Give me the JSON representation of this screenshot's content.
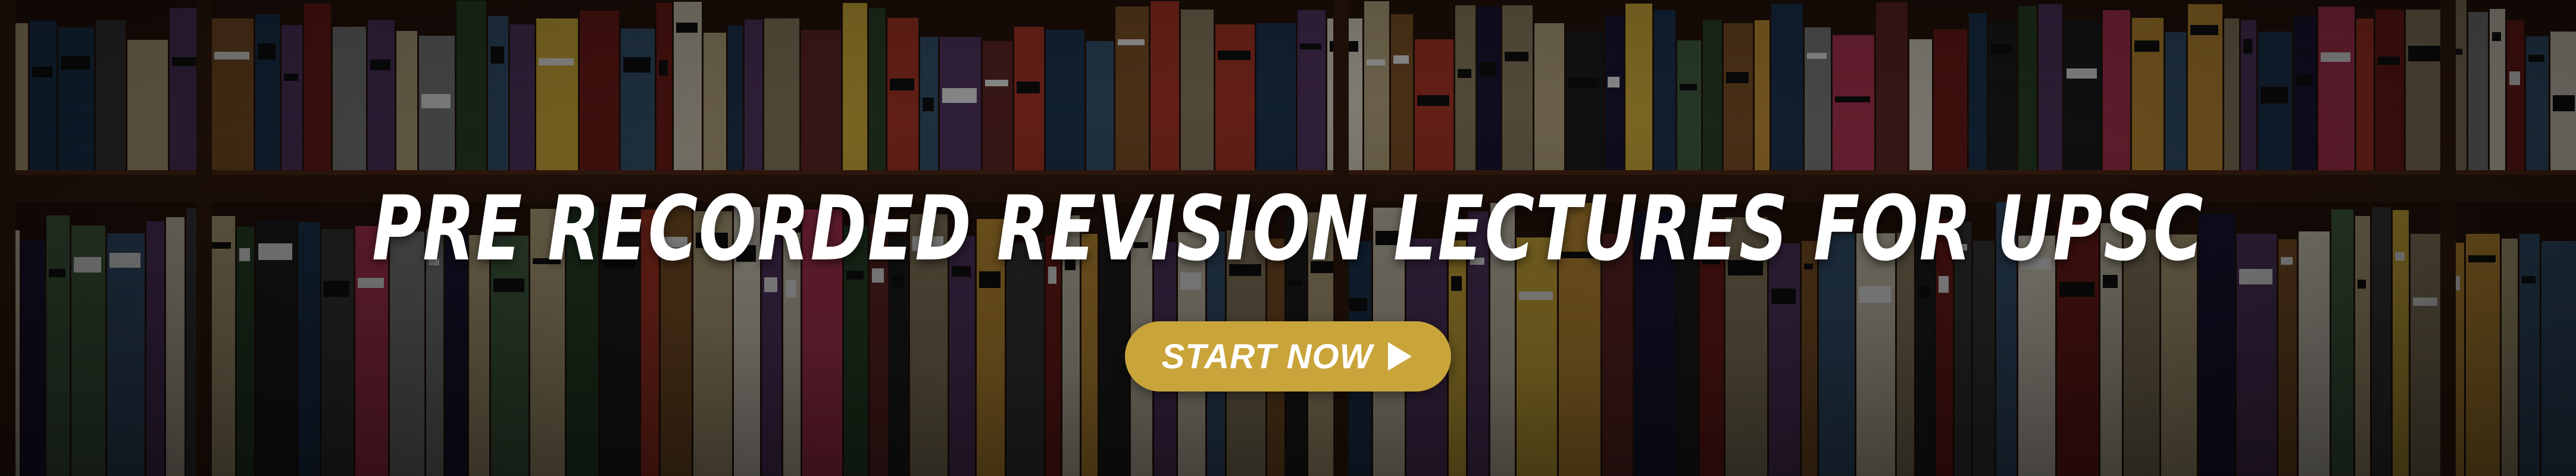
{
  "banner": {
    "headline": "PRE RECORDED REVISION LECTURES FOR UPSC",
    "cta_label": "START NOW",
    "cta_icon": "play-icon",
    "background": "bookshelf-photo"
  },
  "colors": {
    "accent": "#c9a43a",
    "text": "#ffffff",
    "shelf": "#2a150c"
  }
}
